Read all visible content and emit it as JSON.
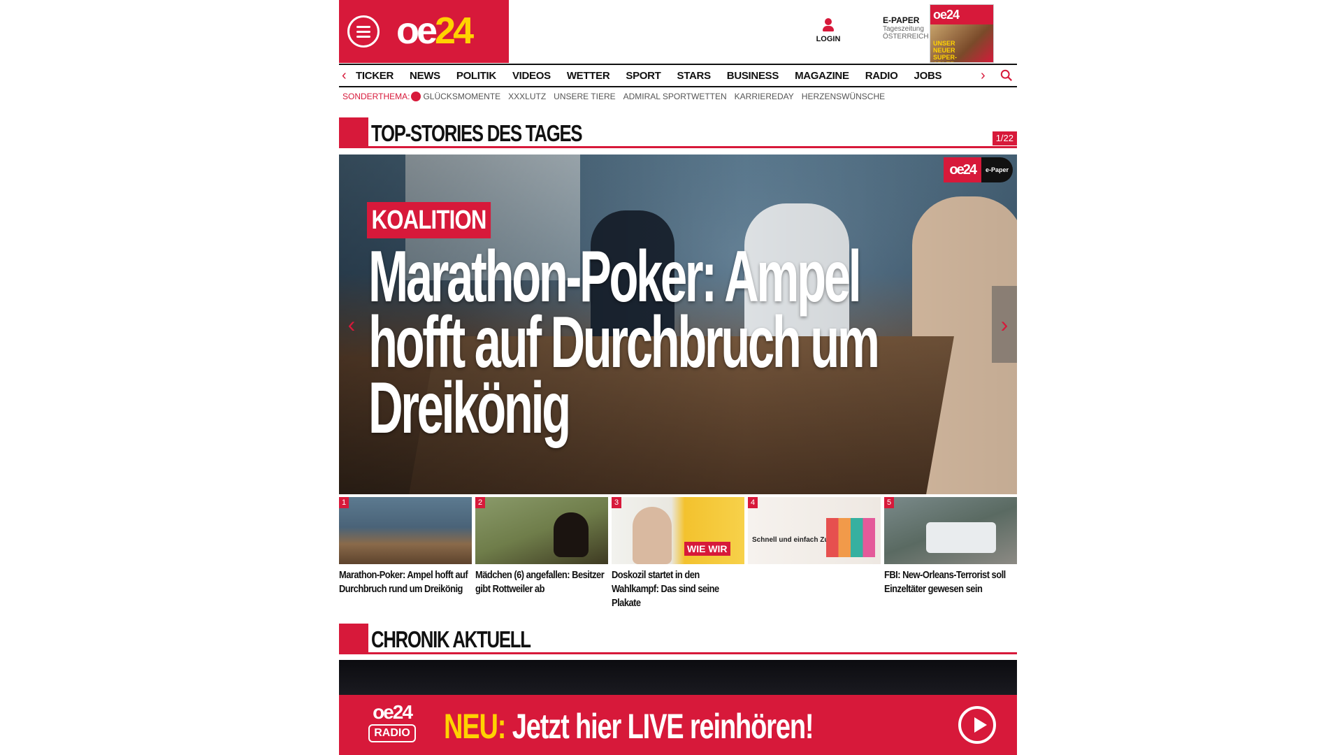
{
  "header": {
    "logo_o": "oe",
    "logo_24": "24",
    "login_label": "LOGIN",
    "epaper_title": "E-PAPER",
    "epaper_sub": "Tageszeitung",
    "epaper_country": "ÖSTERREICH",
    "epaper_thumb_logo": "oe24",
    "epaper_thumb_headline": "UNSER NEUER SUPER-ADLER"
  },
  "nav": {
    "items": [
      "TICKER",
      "NEWS",
      "POLITIK",
      "VIDEOS",
      "WETTER",
      "SPORT",
      "STARS",
      "BUSINESS",
      "MAGAZINE",
      "RADIO",
      "JOBS"
    ]
  },
  "subnav": {
    "label": "SONDERTHEMA:",
    "items": [
      "GLÜCKSMOMENTE",
      "XXXLUTZ",
      "UNSERE TIERE",
      "ADMIRAL SPORTWETTEN",
      "KARRIEREDAY",
      "HERZENSWÜNSCHE"
    ]
  },
  "top_stories": {
    "title": "TOP-STORIES DES TAGES",
    "counter": "1/22",
    "hero": {
      "brand": "oe24",
      "brand_tag": "e-Paper",
      "kicker": "KOALITION",
      "headline": "Marathon-Poker: Ampel hofft auf Durchbruch um Dreikönig"
    },
    "thumbs": [
      {
        "num": "1",
        "caption": "Marathon-Poker: Ampel hofft auf Durchbruch rund um Dreikönig"
      },
      {
        "num": "2",
        "caption": "Mädchen (6) angefallen: Besitzer gibt Rottweiler ab"
      },
      {
        "num": "3",
        "caption": "Doskozil startet in den Wahlkampf: Das sind seine Plakate",
        "overlay": "WIE WIR"
      },
      {
        "num": "4",
        "caption": "",
        "overlay": "Schnell und einfach Zuhause testen."
      },
      {
        "num": "5",
        "caption": "FBI: New-Orleans-Terrorist soll Einzeltäter gewesen sein"
      }
    ]
  },
  "chronik": {
    "title": "CHRONIK AKTUELL"
  },
  "radio": {
    "logo": "oe24",
    "logo_sub": "RADIO",
    "neu": "NEU:",
    "text": " Jetzt hier LIVE reinhören!"
  },
  "colors": {
    "brand_red": "#d7193a",
    "brand_yellow": "#ffd200"
  }
}
